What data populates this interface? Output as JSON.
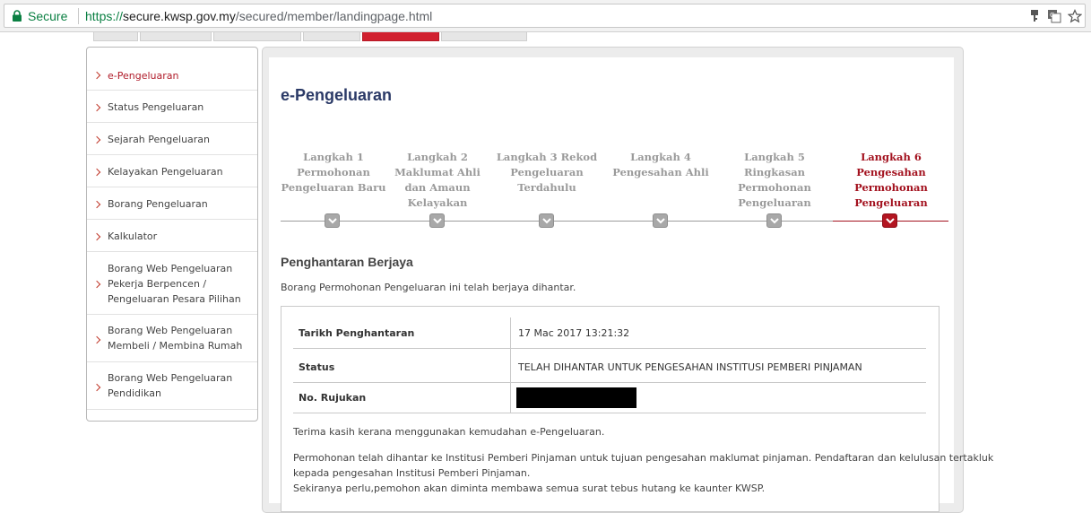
{
  "browser": {
    "secure_label": "Secure",
    "url_scheme": "https://",
    "url_host": "secure.kwsp.gov.my",
    "url_path": "/secured/member/landingpage.html"
  },
  "sidebar": {
    "items": [
      {
        "label": "e-Pengeluaran"
      },
      {
        "label": "Status Pengeluaran"
      },
      {
        "label": "Sejarah Pengeluaran"
      },
      {
        "label": "Kelayakan Pengeluaran"
      },
      {
        "label": "Borang Pengeluaran"
      },
      {
        "label": "Kalkulator"
      },
      {
        "label": "Borang Web Pengeluaran Pekerja Berpencen / Pengeluaran Pesara Pilihan"
      },
      {
        "label": "Borang Web Pengeluaran Membeli / Membina Rumah"
      },
      {
        "label": "Borang Web Pengeluaran Pendidikan"
      }
    ]
  },
  "main": {
    "title": "e-Pengeluaran",
    "steps": [
      {
        "label": "Langkah 1 Permohonan Pengeluaran Baru"
      },
      {
        "label": "Langkah 2 Maklumat Ahli dan Amaun Kelayakan"
      },
      {
        "label": "Langkah 3 Rekod Pengeluaran Terdahulu"
      },
      {
        "label": "Langkah 4 Pengesahan Ahli"
      },
      {
        "label": "Langkah 5 Ringkasan Permohonan Pengeluaran"
      },
      {
        "label": "Langkah 6 Pengesahan Permohonan Pengeluaran"
      }
    ],
    "section_title": "Penghantaran Berjaya",
    "intro": "Borang Permohonan Pengeluaran ini telah berjaya dihantar.",
    "details": {
      "date_label": "Tarikh Penghantaran",
      "date_value": "17 Mac 2017 13:21:32",
      "status_label": "Status",
      "status_value": "TELAH DIHANTAR UNTUK PENGESAHAN INSTITUSI PEMBERI PINJAMAN",
      "ref_label": "No. Rujukan"
    },
    "thanks": "Terima kasih kerana menggunakan kemudahan e-Pengeluaran.",
    "note_line1": "Permohonan telah dihantar ke Institusi Pemberi Pinjaman untuk tujuan pengesahan maklumat pinjaman. Pendaftaran dan kelulusan tertakluk",
    "note_line2": "kepada pengesahan Institusi Pemberi Pinjaman.",
    "note_line3": "Sekiranya perlu,pemohon akan diminta membawa semua surat tebus hutang ke kaunter KWSP."
  },
  "colors": {
    "accent_red": "#a3121f",
    "title_navy": "#2b3a67",
    "secure_green": "#0b8043"
  }
}
